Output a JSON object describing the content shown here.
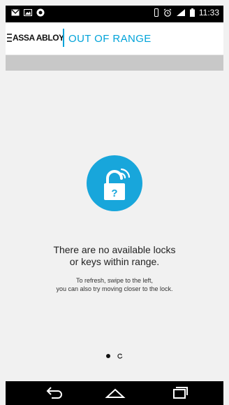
{
  "status_bar": {
    "time": "11:33"
  },
  "header": {
    "brand": "ASSA ABLOY",
    "title": "OUT OF RANGE"
  },
  "empty_state": {
    "heading_line1": "There are no available locks",
    "heading_line2": "or keys within range.",
    "hint_line1": "To refresh, swipe to the left,",
    "hint_line2": "you can also try moving closer to the lock.",
    "lock_symbol": "?"
  },
  "pager": {
    "count": 2,
    "active": 0
  },
  "colors": {
    "accent": "#18a6db",
    "title": "#00a3d9",
    "status_bar": "#000000",
    "nav_bar": "#000000"
  },
  "icons": [
    "mail-icon",
    "image-icon",
    "app-icon",
    "vibrate-icon",
    "alarm-icon",
    "signal-icon",
    "battery-icon",
    "back-icon",
    "home-icon",
    "recent-apps-icon",
    "lock-wireless-icon"
  ]
}
